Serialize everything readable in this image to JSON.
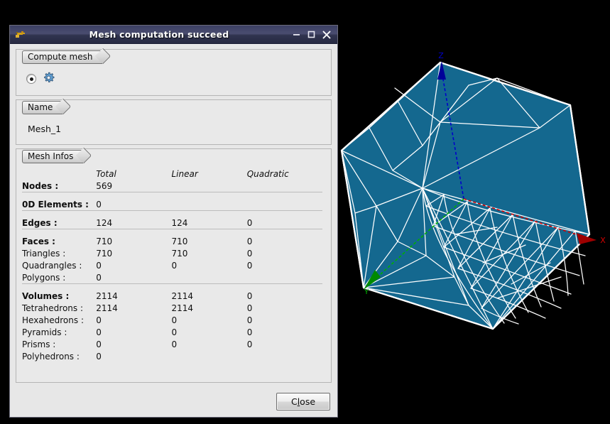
{
  "window": {
    "title": "Mesh computation succeed",
    "icon": "mesh-module-icon",
    "controls": [
      {
        "name": "minimize-button",
        "glyph": "minimize-icon"
      },
      {
        "name": "maximize-button",
        "glyph": "maximize-icon"
      },
      {
        "name": "close-button",
        "glyph": "close-icon"
      }
    ]
  },
  "compute_mesh": {
    "group_label": "Compute mesh",
    "radio_selected": true,
    "icon": "gear-icon"
  },
  "name": {
    "group_label": "Name",
    "value": "Mesh_1"
  },
  "mesh_infos": {
    "group_label": "Mesh Infos",
    "columns": [
      "Total",
      "Linear",
      "Quadratic"
    ],
    "rows": [
      {
        "label": "Nodes :",
        "bold": true,
        "total": "569",
        "linear": "",
        "quadratic": "",
        "rule_after": true
      },
      {
        "label": "0D Elements :",
        "bold": true,
        "total": "0",
        "linear": "",
        "quadratic": "",
        "rule_after": true
      },
      {
        "label": "Edges :",
        "bold": true,
        "total": "124",
        "linear": "124",
        "quadratic": "0",
        "rule_after": true
      },
      {
        "label": "Faces :",
        "bold": true,
        "total": "710",
        "linear": "710",
        "quadratic": "0",
        "rule_after": false
      },
      {
        "label": "Triangles :",
        "bold": false,
        "total": "710",
        "linear": "710",
        "quadratic": "0",
        "rule_after": false
      },
      {
        "label": "Quadrangles :",
        "bold": false,
        "total": "0",
        "linear": "0",
        "quadratic": "0",
        "rule_after": false
      },
      {
        "label": "Polygons :",
        "bold": false,
        "total": "0",
        "linear": "",
        "quadratic": "",
        "rule_after": true
      },
      {
        "label": "Volumes :",
        "bold": true,
        "total": "2114",
        "linear": "2114",
        "quadratic": "0",
        "rule_after": false
      },
      {
        "label": "Tetrahedrons :",
        "bold": false,
        "total": "2114",
        "linear": "2114",
        "quadratic": "0",
        "rule_after": false
      },
      {
        "label": "Hexahedrons :",
        "bold": false,
        "total": "0",
        "linear": "0",
        "quadratic": "0",
        "rule_after": false
      },
      {
        "label": "Pyramids :",
        "bold": false,
        "total": "0",
        "linear": "0",
        "quadratic": "0",
        "rule_after": false
      },
      {
        "label": "Prisms :",
        "bold": false,
        "total": "0",
        "linear": "0",
        "quadratic": "0",
        "rule_after": false
      },
      {
        "label": "Polyhedrons :",
        "bold": false,
        "total": "0",
        "linear": "",
        "quadratic": "",
        "rule_after": false
      }
    ]
  },
  "footer": {
    "close_label_before": "C",
    "close_label_mnemonic": "l",
    "close_label_after": "ose"
  },
  "viewer": {
    "background": "#000000",
    "mesh_fill": "#14688f",
    "mesh_wire": "#ffffff",
    "axes": [
      {
        "name": "x-axis",
        "label": "X",
        "color": "#d40000"
      },
      {
        "name": "y-axis",
        "label": "Y",
        "color": "#00c000"
      },
      {
        "name": "z-axis",
        "label": "Z",
        "color": "#0000cc"
      }
    ]
  }
}
